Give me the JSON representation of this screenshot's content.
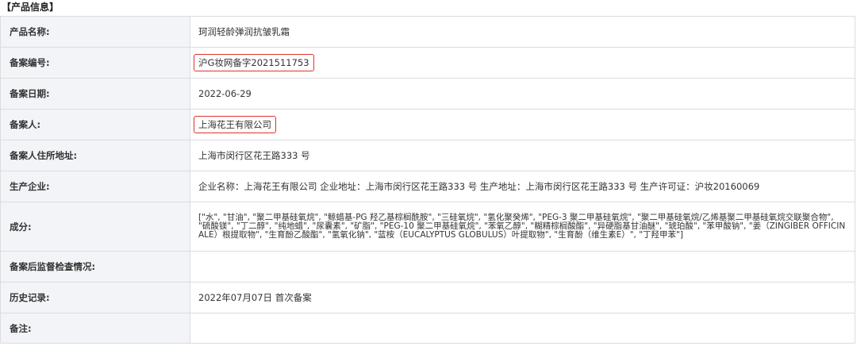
{
  "section_title": "【产品信息】",
  "rows": [
    {
      "label": "产品名称:",
      "value": "珂润轻龄弹润抗皱乳霜"
    },
    {
      "label": "备案编号:",
      "value": "沪G妆网备字2021511753"
    },
    {
      "label": "备案日期:",
      "value": "2022-06-29"
    },
    {
      "label": "备案人:",
      "value": "上海花王有限公司"
    },
    {
      "label": "备案人住所地址:",
      "value": "上海市闵行区花王路333 号"
    },
    {
      "label": "生产企业:",
      "value": "企业名称：上海花王有限公司 企业地址：上海市闵行区花王路333 号 生产地址：上海市闵行区花王路333 号 生产许可证：沪妆20160069"
    },
    {
      "label": "成分:",
      "value": "[\"水\", \"甘油\", \"聚二甲基硅氧烷\", \"鲸蜡基-PG 羟乙基棕榈酰胺\", \"三硅氧烷\", \"氢化聚癸烯\", \"PEG-3 聚二甲基硅氧烷\", \"聚二甲基硅氧烷/乙烯基聚二甲基硅氧烷交联聚合物\", \"硫酸镁\", \"丁二醇\", \"纯地蜡\", \"尿囊素\", \"矿脂\", \"PEG-10 聚二甲基硅氧烷\", \"苯氧乙醇\", \"糊精棕榈酸酯\", \"异硬脂基甘油醚\", \"琥珀酸\", \"苯甲酸钠\", \"姜（ZINGIBER OFFICINALE）根提取物\", \"生育酚乙酸酯\", \"氢氧化钠\", \"蓝桉（EUCALYPTUS GLOBULUS）叶提取物\", \"生育酚（维生素E）\", \"丁羟甲苯\"]"
    },
    {
      "label": "备案后监督检查情况:",
      "value": ""
    },
    {
      "label": "历史记录:",
      "value": "2022年07月07日 首次备案"
    },
    {
      "label": "备注:",
      "value": ""
    }
  ],
  "colors": {
    "label_bg": "#f2f4f7",
    "border": "#dcdcdc",
    "highlight": "#e0332b"
  }
}
